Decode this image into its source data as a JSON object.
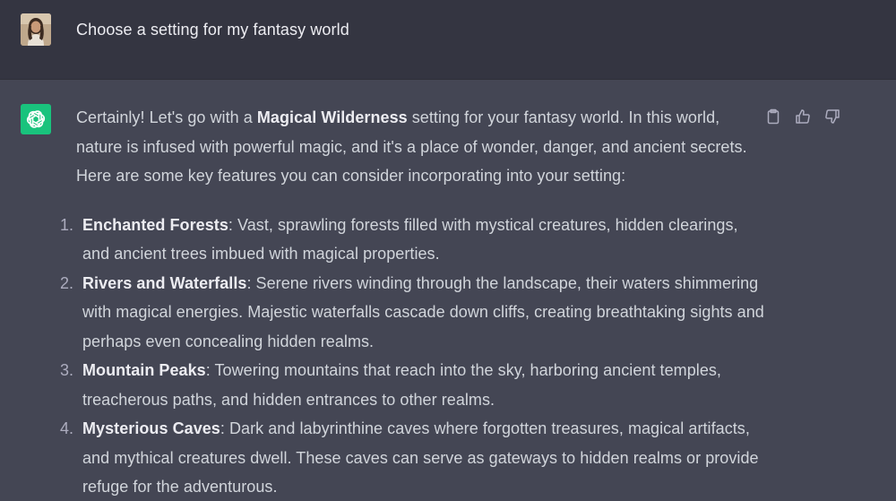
{
  "user_message": {
    "text": "Choose a setting for my fantasy world"
  },
  "assistant_message": {
    "intro_pre": "Certainly! Let's go with a ",
    "intro_bold": "Magical Wilderness",
    "intro_post": " setting for your fantasy world. In this world, nature is infused with powerful magic, and it's a place of wonder, danger, and ancient secrets. Here are some key features you can consider incorporating into your setting:",
    "items": [
      {
        "number": "1.",
        "title": "Enchanted Forests",
        "text": ": Vast, sprawling forests filled with mystical creatures, hidden clearings, and ancient trees imbued with magical properties."
      },
      {
        "number": "2.",
        "title": "Rivers and Waterfalls",
        "text": ": Serene rivers winding through the landscape, their waters shimmering with magical energies. Majestic waterfalls cascade down cliffs, creating breathtaking sights and perhaps even concealing hidden realms."
      },
      {
        "number": "3.",
        "title": "Mountain Peaks",
        "text": ": Towering mountains that reach into the sky, harboring ancient temples, treacherous paths, and hidden entrances to other realms."
      },
      {
        "number": "4.",
        "title": "Mysterious Caves",
        "text": ": Dark and labyrinthine caves where forgotten treasures, magical artifacts, and mythical creatures dwell. These caves can serve as gateways to hidden realms or provide refuge for the adventurous."
      }
    ]
  },
  "icons": {
    "copy": "clipboard-icon",
    "like": "thumbs-up-icon",
    "dislike": "thumbs-down-icon",
    "assistant": "openai-logo-icon",
    "user": "user-avatar"
  },
  "colors": {
    "user_row_bg": "#343541",
    "assistant_row_bg": "#444654",
    "assistant_avatar_bg": "#19c37d",
    "text": "#d1d5db",
    "icon": "#acacbe"
  }
}
